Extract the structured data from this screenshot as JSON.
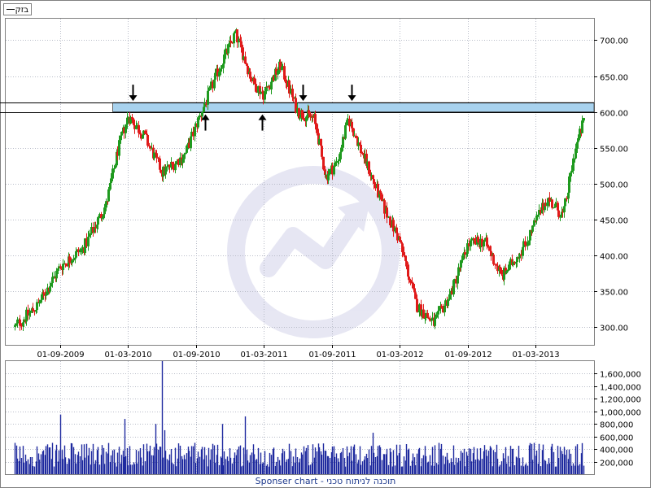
{
  "legend": {
    "label": "בזק"
  },
  "footer": {
    "text": "Sponser chart - תוכנה לניתוח טכני"
  },
  "colors": {
    "up_candle": "#1f9a1f",
    "down_candle": "#e01b1b",
    "volume_bar": "#1f2a9f",
    "grid": "#b8bcc8",
    "resistance_zone": "#a8d2ee",
    "watermark": "#e6e6f3"
  },
  "chart_data": [
    {
      "type": "candlestick",
      "title": "",
      "legend_placement": "top-left",
      "grid": true,
      "x_ticks": [
        "01-09-2009",
        "01-03-2010",
        "01-09-2010",
        "01-03-2011",
        "01-09-2011",
        "01-03-2012",
        "01-09-2012",
        "01-03-2013"
      ],
      "y_ticks": [
        "300.00",
        "350.00",
        "400.00",
        "450.00",
        "500.00",
        "550.00",
        "600.00",
        "650.00",
        "700.00"
      ],
      "ylim": [
        275,
        730
      ],
      "resistance_zone": {
        "low": 600,
        "high": 613
      },
      "horizontal_line": 600,
      "trend_anchors": [
        {
          "date": "2009-05-01",
          "value": 300
        },
        {
          "date": "2009-07-01",
          "value": 330
        },
        {
          "date": "2009-09-01",
          "value": 385
        },
        {
          "date": "2009-11-01",
          "value": 410
        },
        {
          "date": "2010-01-01",
          "value": 470
        },
        {
          "date": "2010-02-01",
          "value": 545
        },
        {
          "date": "2010-03-01",
          "value": 595
        },
        {
          "date": "2010-04-15",
          "value": 565
        },
        {
          "date": "2010-06-01",
          "value": 515
        },
        {
          "date": "2010-08-01",
          "value": 540
        },
        {
          "date": "2010-09-15",
          "value": 600
        },
        {
          "date": "2010-11-01",
          "value": 660
        },
        {
          "date": "2010-12-15",
          "value": 710
        },
        {
          "date": "2011-02-01",
          "value": 640
        },
        {
          "date": "2011-03-01",
          "value": 625
        },
        {
          "date": "2011-04-15",
          "value": 665
        },
        {
          "date": "2011-06-01",
          "value": 600
        },
        {
          "date": "2011-07-15",
          "value": 590
        },
        {
          "date": "2011-08-15",
          "value": 510
        },
        {
          "date": "2011-09-15",
          "value": 530
        },
        {
          "date": "2011-10-15",
          "value": 590
        },
        {
          "date": "2011-12-01",
          "value": 530
        },
        {
          "date": "2012-01-15",
          "value": 470
        },
        {
          "date": "2012-03-01",
          "value": 420
        },
        {
          "date": "2012-04-15",
          "value": 330
        },
        {
          "date": "2012-06-01",
          "value": 305
        },
        {
          "date": "2012-07-15",
          "value": 345
        },
        {
          "date": "2012-09-01",
          "value": 415
        },
        {
          "date": "2012-10-15",
          "value": 420
        },
        {
          "date": "2012-12-01",
          "value": 370
        },
        {
          "date": "2013-02-01",
          "value": 415
        },
        {
          "date": "2013-04-01",
          "value": 480
        },
        {
          "date": "2013-05-15",
          "value": 455
        },
        {
          "date": "2013-06-15",
          "value": 545
        },
        {
          "date": "2013-07-10",
          "value": 590
        }
      ],
      "arrows": [
        {
          "date": "2010-03-15",
          "direction": "down",
          "value": 613
        },
        {
          "date": "2010-09-25",
          "direction": "up",
          "value": 600
        },
        {
          "date": "2011-02-25",
          "direction": "up",
          "value": 600
        },
        {
          "date": "2011-06-15",
          "direction": "down",
          "value": 613
        },
        {
          "date": "2011-10-25",
          "direction": "down",
          "value": 613
        }
      ]
    },
    {
      "type": "bar",
      "title": "",
      "grid": true,
      "y_ticks": [
        "200,000",
        "400,000",
        "600,000",
        "800,000",
        "1,000,000",
        "1,200,000",
        "1,400,000",
        "1,600,000"
      ],
      "ylim": [
        0,
        1800000
      ],
      "spikes": [
        {
          "date": "2009-09-01",
          "value": 950000
        },
        {
          "date": "2010-02-20",
          "value": 880000
        },
        {
          "date": "2010-05-15",
          "value": 800000
        },
        {
          "date": "2010-06-01",
          "value": 1800000
        },
        {
          "date": "2010-06-08",
          "value": 700000
        },
        {
          "date": "2011-01-10",
          "value": 920000
        },
        {
          "date": "2011-12-20",
          "value": 660000
        },
        {
          "date": "2010-11-10",
          "value": 800000
        }
      ]
    }
  ]
}
